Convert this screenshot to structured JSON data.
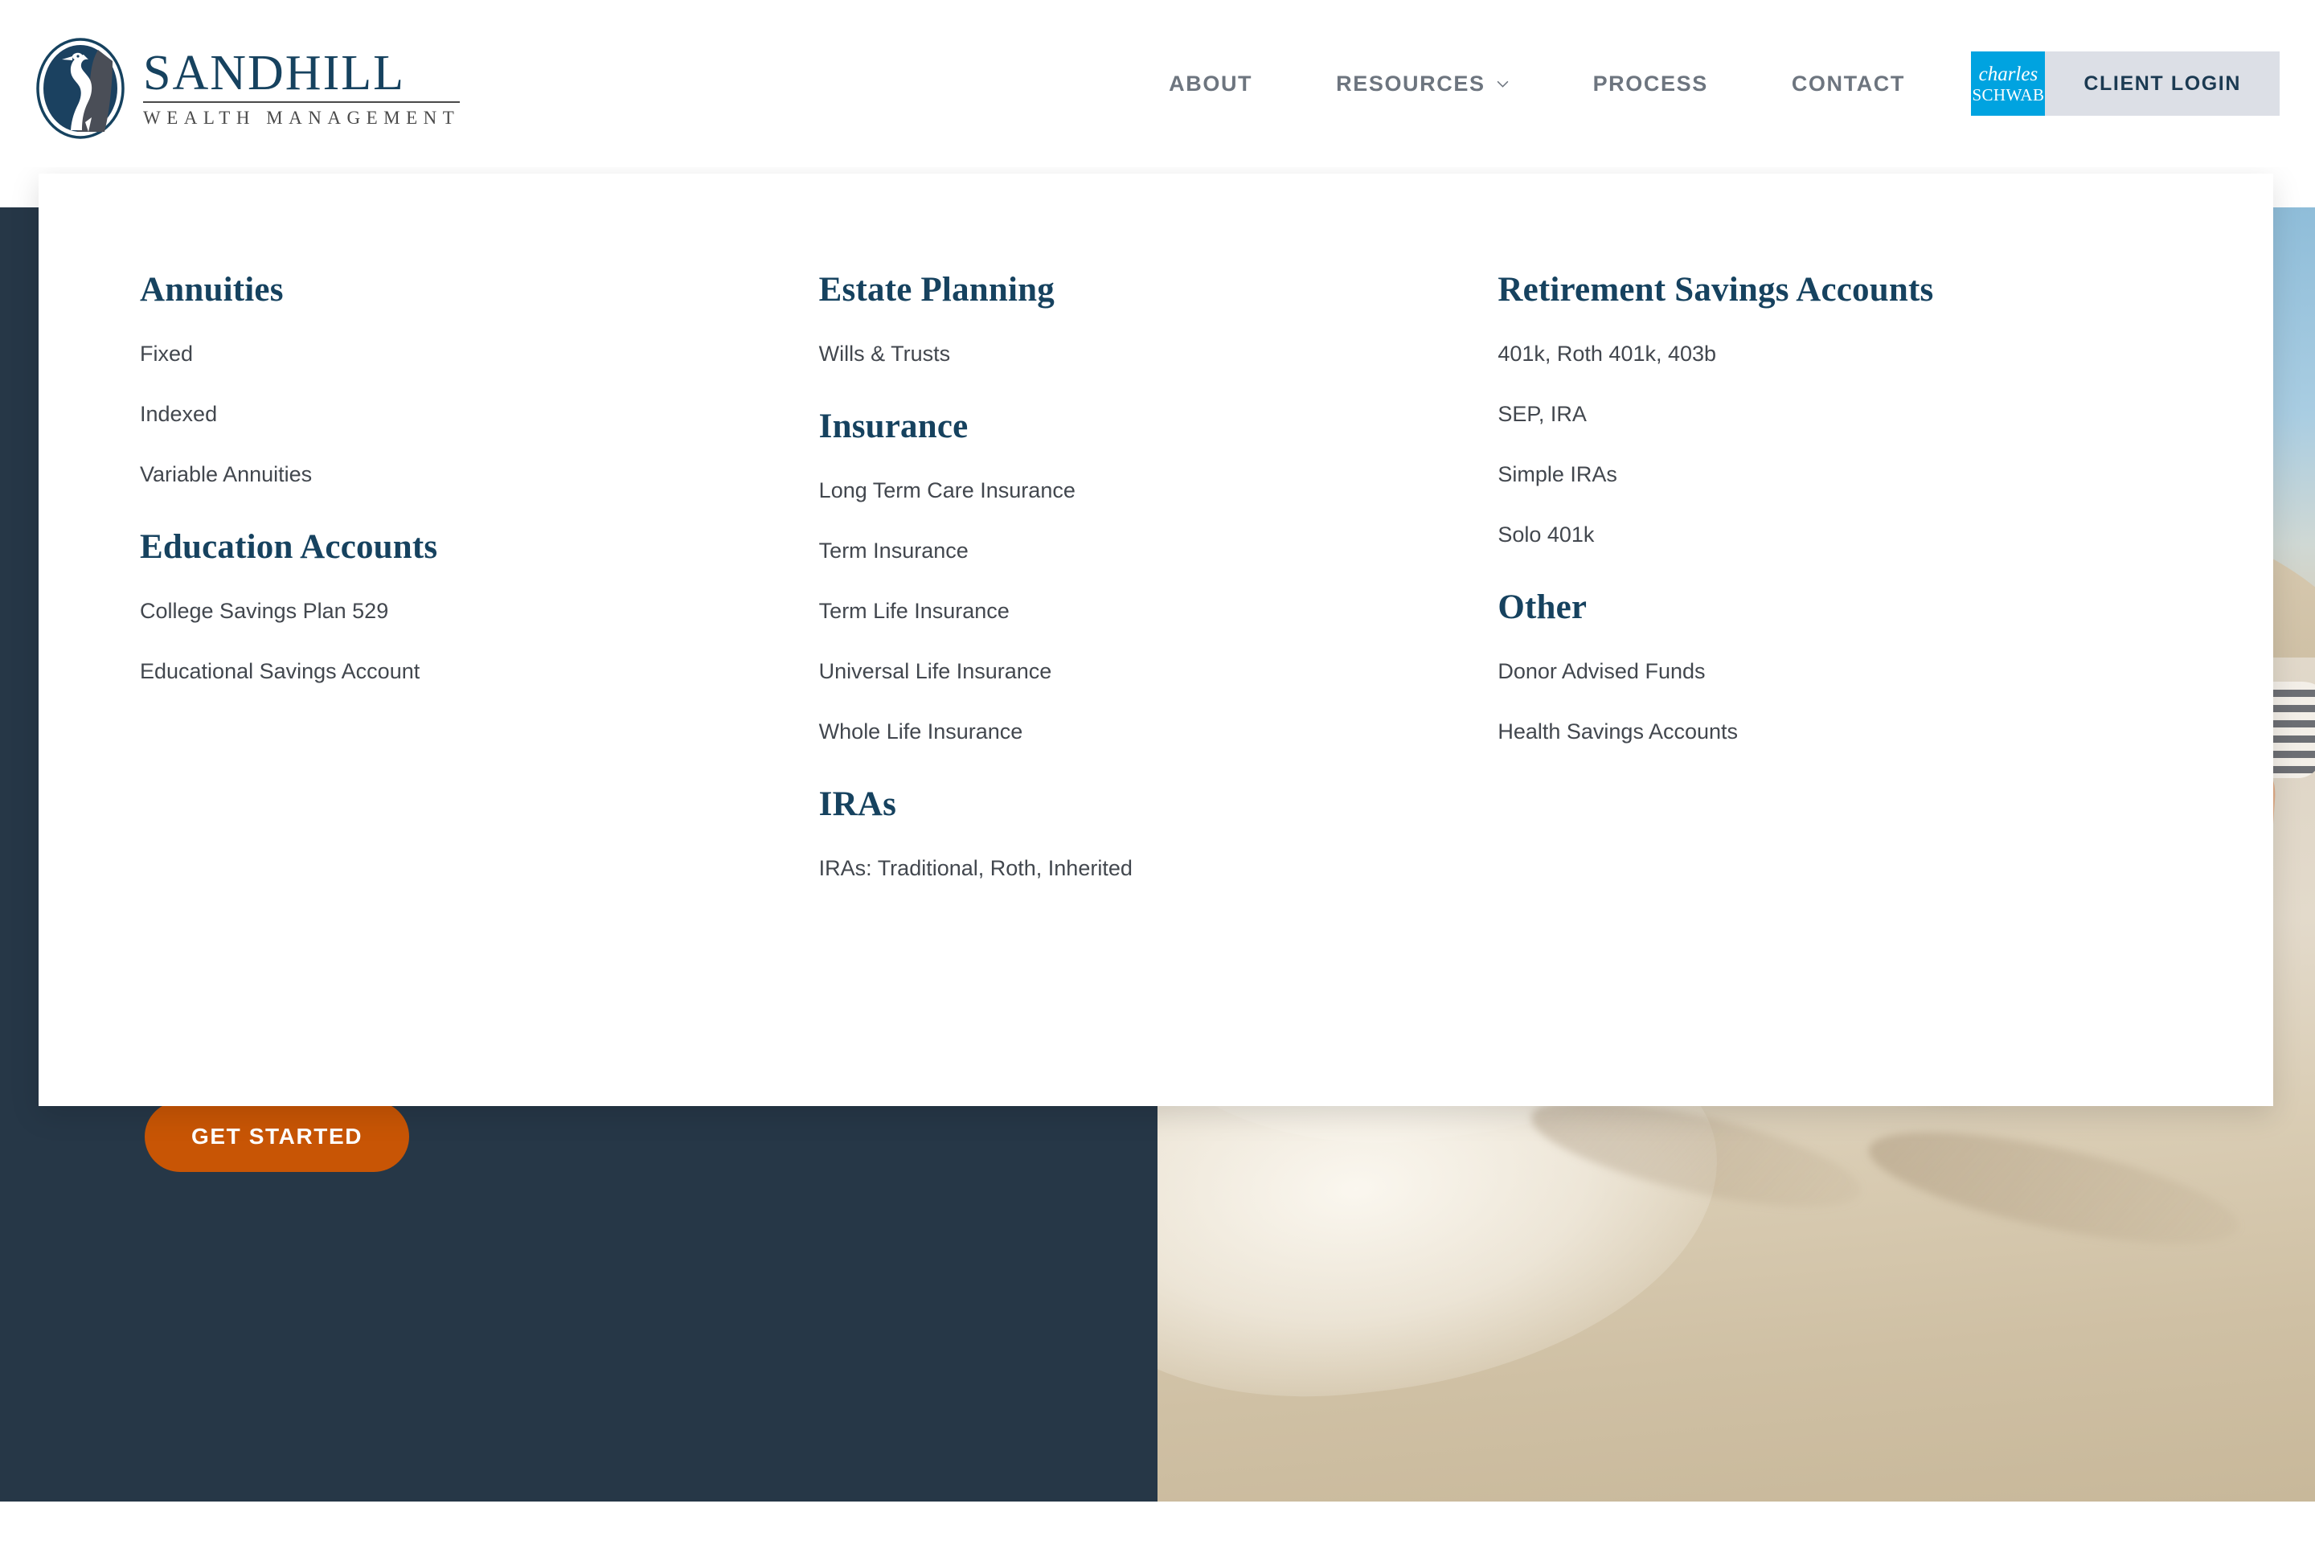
{
  "brand": {
    "name": "SANDHILL",
    "tagline": "WEALTH MANAGEMENT",
    "logo_icon": "sandhill-crane-oval-logo",
    "navy": "#16425F",
    "accent_orange": "#C85505",
    "hero_navy": "#263747"
  },
  "nav": {
    "items": [
      {
        "label": "ABOUT",
        "has_dropdown": false
      },
      {
        "label": "RESOURCES",
        "has_dropdown": true,
        "chevron_icon": "chevron-down-icon"
      },
      {
        "label": "PROCESS",
        "has_dropdown": false
      },
      {
        "label": "CONTACT",
        "has_dropdown": false
      }
    ],
    "client_login": {
      "label": "CLIENT LOGIN",
      "partner_logo_line1": "charles",
      "partner_logo_line2": "SCHWAB",
      "partner_color": "#00A3E0",
      "button_bg": "#DCDFE6"
    }
  },
  "dropdown": {
    "open_for": "RESOURCES",
    "columns": [
      {
        "groups": [
          {
            "heading": "Annuities",
            "links": [
              "Fixed",
              "Indexed",
              "Variable Annuities"
            ]
          },
          {
            "heading": "Education Accounts",
            "links": [
              "College Savings Plan 529",
              "Educational Savings Account"
            ]
          }
        ]
      },
      {
        "groups": [
          {
            "heading": "Estate Planning",
            "links": [
              "Wills & Trusts"
            ]
          },
          {
            "heading": "Insurance",
            "links": [
              "Long Term Care Insurance",
              "Term Insurance",
              "Term Life Insurance",
              "Universal Life Insurance",
              "Whole Life Insurance"
            ]
          },
          {
            "heading": "IRAs",
            "links": [
              "IRAs: Traditional, Roth, Inherited"
            ]
          }
        ]
      },
      {
        "groups": [
          {
            "heading": "Retirement Savings Accounts",
            "links": [
              "401k, Roth 401k, 403b",
              "SEP, IRA",
              "Simple IRAs",
              "Solo 401k"
            ]
          },
          {
            "heading": "Other",
            "links": [
              "Donor Advised Funds",
              "Health Savings Accounts"
            ]
          }
        ]
      }
    ]
  },
  "hero": {
    "cta_label": "GET STARTED",
    "image_description": "people-walking-on-beach-photo"
  }
}
